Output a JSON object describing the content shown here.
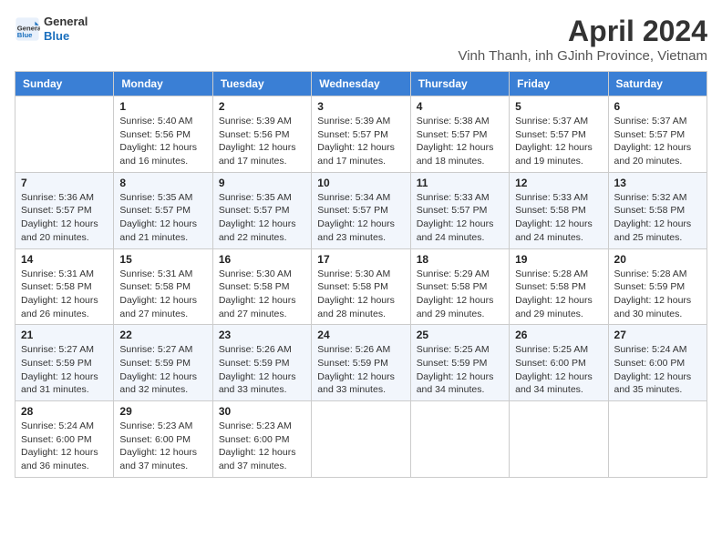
{
  "logo": {
    "line1": "General",
    "line2": "Blue"
  },
  "title": "April 2024",
  "subtitle": "Vinh Thanh, inh GJinh Province, Vietnam",
  "weekdays": [
    "Sunday",
    "Monday",
    "Tuesday",
    "Wednesday",
    "Thursday",
    "Friday",
    "Saturday"
  ],
  "weeks": [
    [
      {
        "day": "",
        "info": ""
      },
      {
        "day": "1",
        "info": "Sunrise: 5:40 AM\nSunset: 5:56 PM\nDaylight: 12 hours\nand 16 minutes."
      },
      {
        "day": "2",
        "info": "Sunrise: 5:39 AM\nSunset: 5:56 PM\nDaylight: 12 hours\nand 17 minutes."
      },
      {
        "day": "3",
        "info": "Sunrise: 5:39 AM\nSunset: 5:57 PM\nDaylight: 12 hours\nand 17 minutes."
      },
      {
        "day": "4",
        "info": "Sunrise: 5:38 AM\nSunset: 5:57 PM\nDaylight: 12 hours\nand 18 minutes."
      },
      {
        "day": "5",
        "info": "Sunrise: 5:37 AM\nSunset: 5:57 PM\nDaylight: 12 hours\nand 19 minutes."
      },
      {
        "day": "6",
        "info": "Sunrise: 5:37 AM\nSunset: 5:57 PM\nDaylight: 12 hours\nand 20 minutes."
      }
    ],
    [
      {
        "day": "7",
        "info": "Sunrise: 5:36 AM\nSunset: 5:57 PM\nDaylight: 12 hours\nand 20 minutes."
      },
      {
        "day": "8",
        "info": "Sunrise: 5:35 AM\nSunset: 5:57 PM\nDaylight: 12 hours\nand 21 minutes."
      },
      {
        "day": "9",
        "info": "Sunrise: 5:35 AM\nSunset: 5:57 PM\nDaylight: 12 hours\nand 22 minutes."
      },
      {
        "day": "10",
        "info": "Sunrise: 5:34 AM\nSunset: 5:57 PM\nDaylight: 12 hours\nand 23 minutes."
      },
      {
        "day": "11",
        "info": "Sunrise: 5:33 AM\nSunset: 5:57 PM\nDaylight: 12 hours\nand 24 minutes."
      },
      {
        "day": "12",
        "info": "Sunrise: 5:33 AM\nSunset: 5:58 PM\nDaylight: 12 hours\nand 24 minutes."
      },
      {
        "day": "13",
        "info": "Sunrise: 5:32 AM\nSunset: 5:58 PM\nDaylight: 12 hours\nand 25 minutes."
      }
    ],
    [
      {
        "day": "14",
        "info": "Sunrise: 5:31 AM\nSunset: 5:58 PM\nDaylight: 12 hours\nand 26 minutes."
      },
      {
        "day": "15",
        "info": "Sunrise: 5:31 AM\nSunset: 5:58 PM\nDaylight: 12 hours\nand 27 minutes."
      },
      {
        "day": "16",
        "info": "Sunrise: 5:30 AM\nSunset: 5:58 PM\nDaylight: 12 hours\nand 27 minutes."
      },
      {
        "day": "17",
        "info": "Sunrise: 5:30 AM\nSunset: 5:58 PM\nDaylight: 12 hours\nand 28 minutes."
      },
      {
        "day": "18",
        "info": "Sunrise: 5:29 AM\nSunset: 5:58 PM\nDaylight: 12 hours\nand 29 minutes."
      },
      {
        "day": "19",
        "info": "Sunrise: 5:28 AM\nSunset: 5:58 PM\nDaylight: 12 hours\nand 29 minutes."
      },
      {
        "day": "20",
        "info": "Sunrise: 5:28 AM\nSunset: 5:59 PM\nDaylight: 12 hours\nand 30 minutes."
      }
    ],
    [
      {
        "day": "21",
        "info": "Sunrise: 5:27 AM\nSunset: 5:59 PM\nDaylight: 12 hours\nand 31 minutes."
      },
      {
        "day": "22",
        "info": "Sunrise: 5:27 AM\nSunset: 5:59 PM\nDaylight: 12 hours\nand 32 minutes."
      },
      {
        "day": "23",
        "info": "Sunrise: 5:26 AM\nSunset: 5:59 PM\nDaylight: 12 hours\nand 33 minutes."
      },
      {
        "day": "24",
        "info": "Sunrise: 5:26 AM\nSunset: 5:59 PM\nDaylight: 12 hours\nand 33 minutes."
      },
      {
        "day": "25",
        "info": "Sunrise: 5:25 AM\nSunset: 5:59 PM\nDaylight: 12 hours\nand 34 minutes."
      },
      {
        "day": "26",
        "info": "Sunrise: 5:25 AM\nSunset: 6:00 PM\nDaylight: 12 hours\nand 34 minutes."
      },
      {
        "day": "27",
        "info": "Sunrise: 5:24 AM\nSunset: 6:00 PM\nDaylight: 12 hours\nand 35 minutes."
      }
    ],
    [
      {
        "day": "28",
        "info": "Sunrise: 5:24 AM\nSunset: 6:00 PM\nDaylight: 12 hours\nand 36 minutes."
      },
      {
        "day": "29",
        "info": "Sunrise: 5:23 AM\nSunset: 6:00 PM\nDaylight: 12 hours\nand 37 minutes."
      },
      {
        "day": "30",
        "info": "Sunrise: 5:23 AM\nSunset: 6:00 PM\nDaylight: 12 hours\nand 37 minutes."
      },
      {
        "day": "",
        "info": ""
      },
      {
        "day": "",
        "info": ""
      },
      {
        "day": "",
        "info": ""
      },
      {
        "day": "",
        "info": ""
      }
    ]
  ]
}
